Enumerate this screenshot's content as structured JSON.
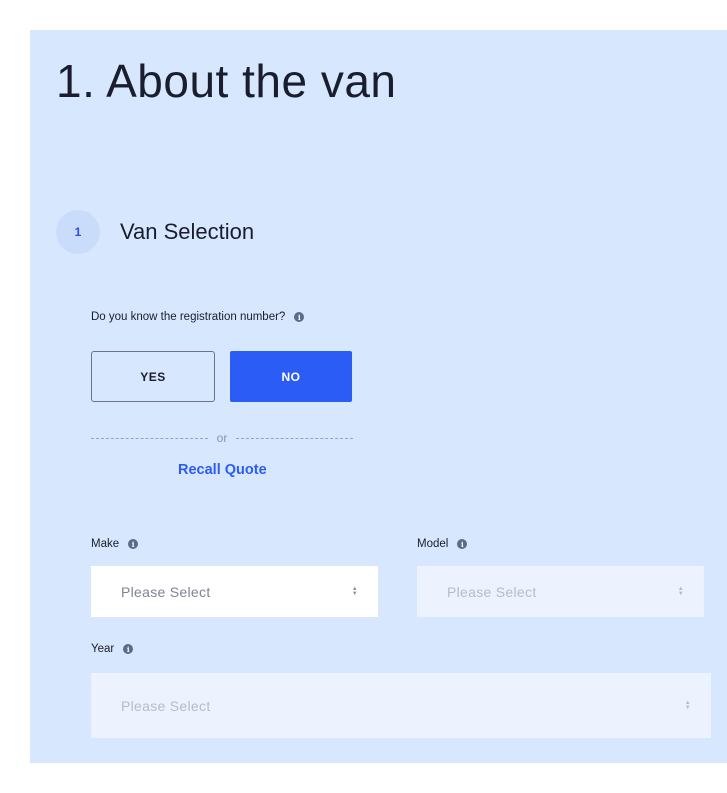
{
  "header": {
    "title": "1. About the van"
  },
  "step": {
    "number": "1",
    "title": "Van Selection"
  },
  "registration": {
    "question": "Do you know the registration number?",
    "yes_label": "YES",
    "no_label": "NO",
    "selected": "NO",
    "divider_text": "or",
    "recall_label": "Recall Quote"
  },
  "fields": {
    "make": {
      "label": "Make",
      "placeholder": "Please Select"
    },
    "model": {
      "label": "Model",
      "placeholder": "Please Select"
    },
    "year": {
      "label": "Year",
      "placeholder": "Please Select"
    }
  },
  "icons": {
    "info": "info-icon",
    "select_arrows": "chevron-up-down-icon"
  },
  "colors": {
    "panel_background": "#d7e7fd",
    "accent": "#2b5cf6",
    "text": "#1a1d2e"
  }
}
